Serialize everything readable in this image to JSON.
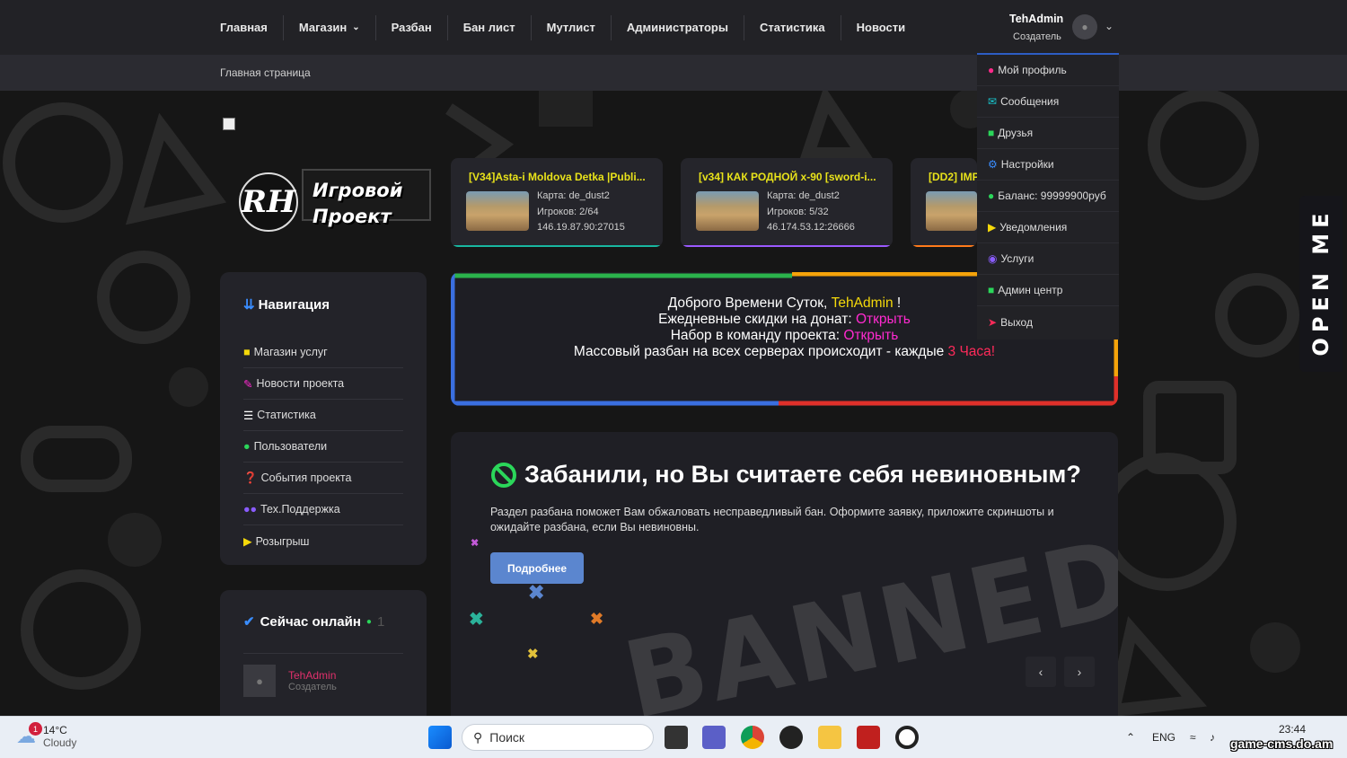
{
  "nav": {
    "items": [
      "Главная",
      "Магазин",
      "Разбан",
      "Бан лист",
      "Мутлист",
      "Администраторы",
      "Статистика",
      "Новости"
    ]
  },
  "breadcrumb": "Главная страница",
  "logo": {
    "mark": "RH",
    "line1": "Игровой",
    "line2": "Проект"
  },
  "servers": [
    {
      "title": "[V34]Asta-i Moldova Detka |Publi...",
      "map": "Карта: de_dust2",
      "players": "Игроков: 2/64",
      "address": "146.19.87.90:27015",
      "color": "#18b7a0"
    },
    {
      "title": "[v34] КАК РОДНОЙ x-90 [sword-i...",
      "map": "Карта: de_dust2",
      "players": "Игроков: 5/32",
      "address": "46.174.53.12:26666",
      "color": "#9b59ff"
    },
    {
      "title": "[DD2] IMP",
      "map": "",
      "players": "",
      "address": "",
      "color": "#ff7a1a"
    }
  ],
  "sidebar": {
    "title": "Навигация",
    "items": [
      {
        "label": "Магазин услуг",
        "icon": "basket-icon",
        "color": "#f5d90a"
      },
      {
        "label": "Новости проекта",
        "icon": "pencil-icon",
        "color": "#ff2ad0"
      },
      {
        "label": "Статистика",
        "icon": "list-icon",
        "color": "#ffffff"
      },
      {
        "label": "Пользователи",
        "icon": "user-icon",
        "color": "#2bd65a"
      },
      {
        "label": "События проекта",
        "icon": "question-icon",
        "color": "#18c8d0"
      },
      {
        "label": "Тех.Поддержка",
        "icon": "users-icon",
        "color": "#8a5cff"
      },
      {
        "label": "Розыгрыш",
        "icon": "megaphone-icon",
        "color": "#f5d90a"
      }
    ]
  },
  "online": {
    "title": "Сейчас онлайн",
    "count": "1",
    "user": {
      "name": "TehAdmin",
      "role": "Создатель"
    }
  },
  "welcome": {
    "greeting": "Доброго Времени Суток, ",
    "name": "TehAdmin",
    "excl": " !",
    "line2": "Ежедневные скидки на донат: ",
    "line2_link": "Открыть",
    "line3": "Набор в команду проекта: ",
    "line3_link": "Открыть",
    "line4": "Массовый разбан на всех серверах происходит - каждые ",
    "line4_hl": "3 Часа!"
  },
  "ban": {
    "title": "Забанили, но Вы считаете себя невиновным?",
    "desc": "Раздел разбана поможет Вам обжаловать несправедливый бан. Оформите заявку, приложите скриншоты и ожидайте разбана, если Вы невиновны.",
    "button": "Подробнее",
    "watermark": "BANNED"
  },
  "user": {
    "name": "TehAdmin",
    "role": "Создатель"
  },
  "dropdown": [
    {
      "label": "Мой профиль",
      "icon": "person-icon",
      "color": "#ff2a8a"
    },
    {
      "label": "Сообщения",
      "icon": "envelope-icon",
      "color": "#18c8d0"
    },
    {
      "label": "Друзья",
      "icon": "handshake-icon",
      "color": "#2bd65a"
    },
    {
      "label": "Настройки",
      "icon": "gear-icon",
      "color": "#3a8dff"
    },
    {
      "label": "Баланс: 99999900руб",
      "icon": "piggy-icon",
      "color": "#2bd65a"
    },
    {
      "label": "Уведомления",
      "icon": "megaphone-icon",
      "color": "#f5d90a"
    },
    {
      "label": "Услуги",
      "icon": "user-circle-icon",
      "color": "#8a5cff"
    },
    {
      "label": "Админ центр",
      "icon": "lock-icon",
      "color": "#2bd65a"
    },
    {
      "label": "Выход",
      "icon": "exit-icon",
      "color": "#ff2a5a"
    }
  ],
  "openme": "OPEN ME",
  "taskbar": {
    "weather_temp": "14°C",
    "weather_cond": "Cloudy",
    "weather_badge": "1",
    "search_placeholder": "Поиск",
    "lang": "ENG",
    "time": "23:44",
    "watermark": "game-cms.do.am"
  }
}
